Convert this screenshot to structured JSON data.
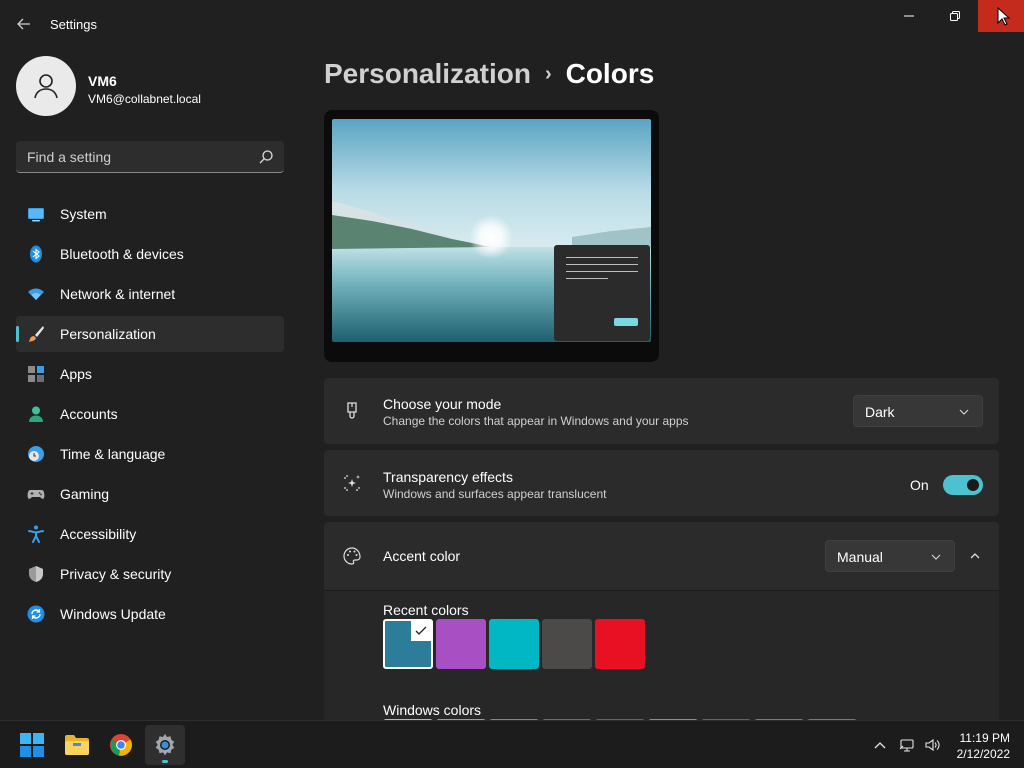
{
  "window": {
    "title": "Settings"
  },
  "profile": {
    "name": "VM6",
    "email": "VM6@collabnet.local"
  },
  "search": {
    "placeholder": "Find a setting"
  },
  "sidebar": {
    "items": [
      {
        "label": "System",
        "icon": "system-icon"
      },
      {
        "label": "Bluetooth & devices",
        "icon": "bluetooth-icon"
      },
      {
        "label": "Network & internet",
        "icon": "wifi-icon"
      },
      {
        "label": "Personalization",
        "icon": "brush-icon",
        "active": true
      },
      {
        "label": "Apps",
        "icon": "apps-icon"
      },
      {
        "label": "Accounts",
        "icon": "person-icon"
      },
      {
        "label": "Time & language",
        "icon": "clock-globe-icon"
      },
      {
        "label": "Gaming",
        "icon": "gamepad-icon"
      },
      {
        "label": "Accessibility",
        "icon": "accessibility-icon"
      },
      {
        "label": "Privacy & security",
        "icon": "shield-icon"
      },
      {
        "label": "Windows Update",
        "icon": "update-icon"
      }
    ]
  },
  "breadcrumb": {
    "parent": "Personalization",
    "separator": "›",
    "current": "Colors"
  },
  "mode_card": {
    "title": "Choose your mode",
    "description": "Change the colors that appear in Windows and your apps",
    "value": "Dark"
  },
  "transparency_card": {
    "title": "Transparency effects",
    "description": "Windows and surfaces appear translucent",
    "state": "On",
    "enabled": true
  },
  "accent_card": {
    "title": "Accent color",
    "value": "Manual",
    "expanded": true
  },
  "recent_colors": {
    "label": "Recent colors",
    "colors": [
      "#2d7d9a",
      "#a84fc4",
      "#00b7c3",
      "#4c4a48",
      "#e81123"
    ],
    "selected_index": 0
  },
  "windows_colors": {
    "label": "Windows colors",
    "colors": [
      "#ffb900",
      "#ff8c00",
      "#f7630c",
      "#ca5010",
      "#da3b01",
      "#ef6950",
      "#d13438",
      "#ff4343",
      "#e74856"
    ]
  },
  "taskbar": {
    "apps": [
      {
        "name": "start-button",
        "icon": "windows-logo-icon"
      },
      {
        "name": "file-explorer-button",
        "icon": "folder-icon"
      },
      {
        "name": "chrome-button",
        "icon": "chrome-icon"
      },
      {
        "name": "settings-button",
        "icon": "gear-icon",
        "active": true
      }
    ],
    "time": "11:19 PM",
    "date": "2/12/2022"
  },
  "accent": "#4cc2d0",
  "close_color": "#c42b1c"
}
